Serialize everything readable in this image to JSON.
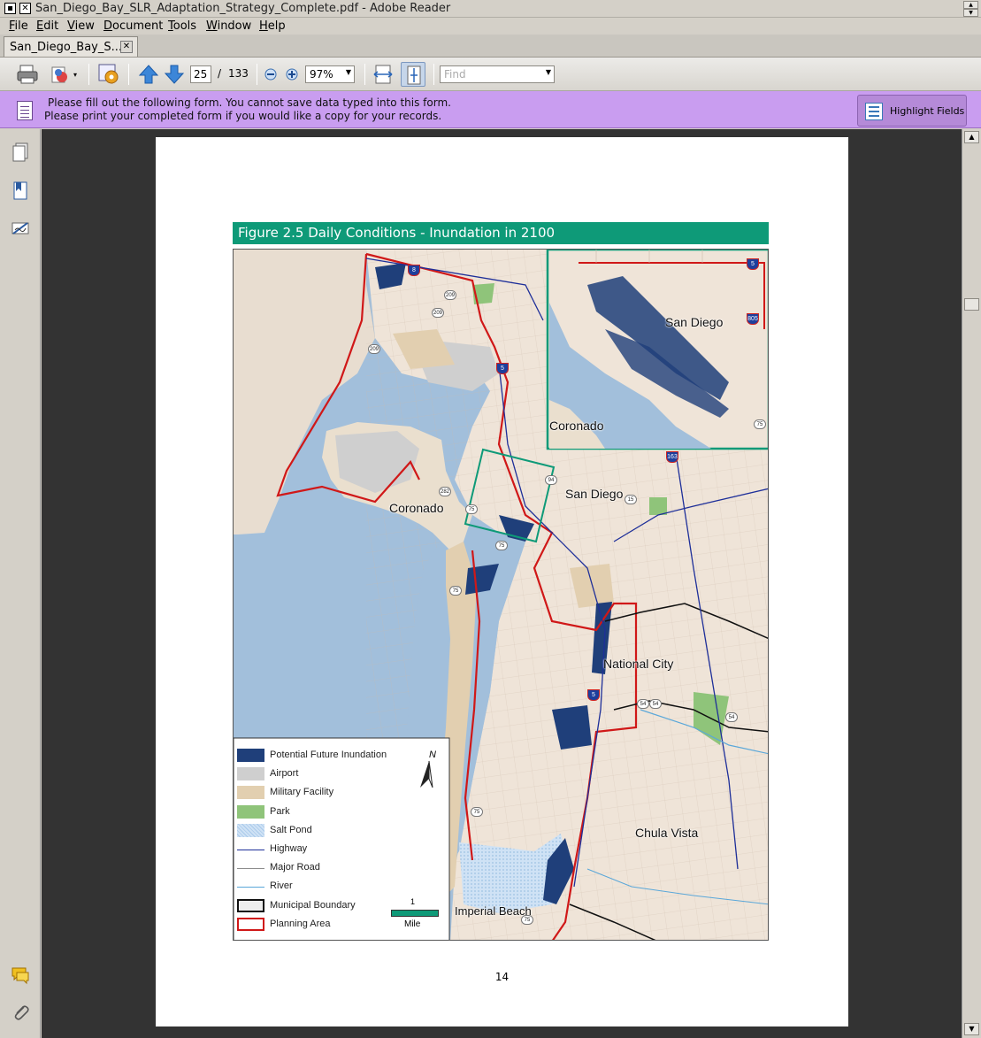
{
  "window": {
    "title": "San_Diego_Bay_SLR_Adaptation_Strategy_Complete.pdf - Adobe Reader"
  },
  "menu": {
    "items": [
      {
        "label": "File",
        "accel": "F",
        "rest": "ile"
      },
      {
        "label": "Edit",
        "accel": "E",
        "rest": "dit"
      },
      {
        "label": "View",
        "accel": "V",
        "rest": "iew"
      },
      {
        "label": "Document",
        "accel": "D",
        "rest": "ocument"
      },
      {
        "label": "Tools",
        "accel": "T",
        "rest": "ools"
      },
      {
        "label": "Window",
        "accel": "W",
        "rest": "indow"
      },
      {
        "label": "Help",
        "accel": "H",
        "rest": "elp"
      }
    ]
  },
  "tab": {
    "label": "San_Diego_Bay_S...",
    "close": "✕"
  },
  "toolbar": {
    "page_current": "25",
    "page_separator": "/",
    "page_total": "133",
    "zoom": "97%",
    "find_placeholder": "Find"
  },
  "banner": {
    "line1": "Please fill out the following form. You cannot save data typed into this form.",
    "line2": "Please print your completed form if you would like a copy for your records.",
    "highlight_button": "Highlight Fields"
  },
  "document": {
    "figure_title": "Figure 2.5 Daily Conditions - Inundation in 2100",
    "page_number": "14",
    "map_labels": {
      "inset_san_diego": "San Diego",
      "inset_coronado": "Coronado",
      "coronado": "Coronado",
      "san_diego": "San Diego",
      "national_city": "National City",
      "chula_vista": "Chula Vista",
      "imperial_beach": "Imperial Beach"
    },
    "route_shields": [
      "8",
      "5",
      "209",
      "209",
      "209",
      "5",
      "163",
      "94",
      "15",
      "282",
      "75",
      "75",
      "75",
      "54",
      "54",
      "54",
      "5",
      "805",
      "75",
      "75",
      "75"
    ],
    "legend": {
      "items": [
        {
          "label": "Potential Future Inundation",
          "color": "#1f3f7a"
        },
        {
          "label": "Airport",
          "color": "#cfcfcf"
        },
        {
          "label": "Military Facility",
          "color": "#e2cfb0"
        },
        {
          "label": "Park",
          "color": "#8fc47a"
        },
        {
          "label": "Salt Pond",
          "color": "#cfe2f5"
        },
        {
          "label": "Highway",
          "color": "#1e2f99"
        },
        {
          "label": "Major Road",
          "color": "#8c8c8c"
        },
        {
          "label": "River",
          "color": "#5aa7d9"
        },
        {
          "label": "Municipal Boundary",
          "color": "#111111"
        },
        {
          "label": "Planning Area",
          "color": "#d01818"
        }
      ],
      "scale_value": "1",
      "scale_unit": "Mile",
      "north_label": "N"
    }
  },
  "colors": {
    "banner": "#c99df0",
    "figure_header": "#0e9a78",
    "water": "#a2bfdb",
    "land": "#efe4d8"
  }
}
